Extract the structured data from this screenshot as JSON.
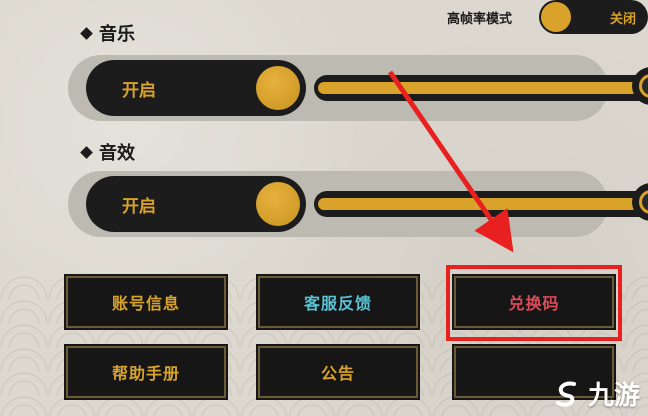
{
  "high_frame_rate": {
    "label": "高帧率模式",
    "state": "关闭"
  },
  "music": {
    "label": "音乐",
    "toggle_text": "开启",
    "level": 1.0
  },
  "sfx": {
    "label": "音效",
    "toggle_text": "开启",
    "level": 1.0
  },
  "buttons": {
    "account_info": "账号信息",
    "customer_service": "客服反馈",
    "redeem_code": "兑换码",
    "help_manual": "帮助手册",
    "announcement": "公告"
  },
  "watermark": {
    "text": "九游",
    "icon": "s-logo-icon"
  },
  "colors": {
    "accent_gold": "#d9a32b",
    "annotation_red": "#e8201f",
    "service_blue": "#59c3d6",
    "redeem_red": "#e0495a"
  }
}
